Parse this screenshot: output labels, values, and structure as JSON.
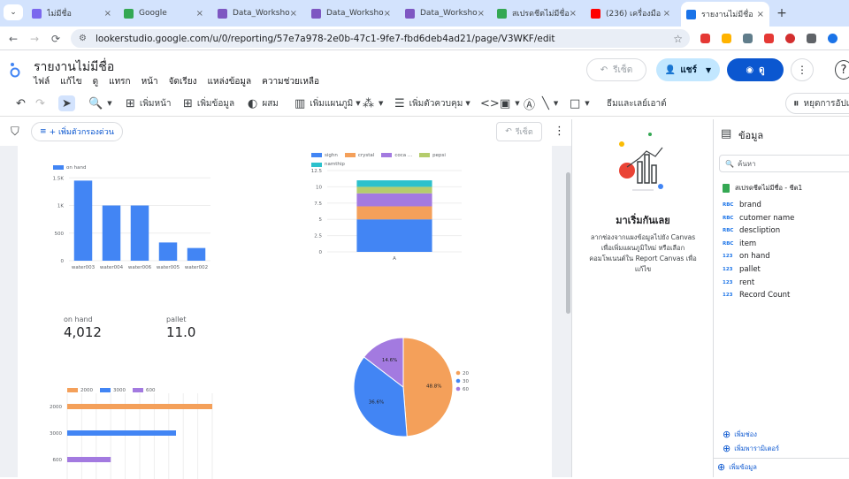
{
  "browser": {
    "tabs": [
      {
        "label": "ไม่มีชื่อ",
        "color": "#7b68ee"
      },
      {
        "label": "Google",
        "color": "#34a853"
      },
      {
        "label": "Data_Workshop",
        "color": "#7e57c2"
      },
      {
        "label": "Data_Workshop",
        "color": "#7e57c2"
      },
      {
        "label": "Data_Workshop",
        "color": "#7e57c2"
      },
      {
        "label": "สเปรดชีตไม่มีชื่อ - ",
        "color": "#34a853"
      },
      {
        "label": "(236) เครื่องมือ G",
        "color": "#ff0000"
      },
      {
        "label": "รายงานไม่มีชื่อ",
        "color": "#1a73e8"
      }
    ],
    "new_tab": "+",
    "url": "lookerstudio.google.com/u/0/reporting/57e7a978-2e0b-47c1-9fe7-fbd6deb4ad21/page/V3WKF/edit",
    "back": "←",
    "forward": "→",
    "reload": "⟳",
    "star": "☆"
  },
  "header": {
    "title": "รายงานไม่มีชื่อ",
    "menu": [
      "ไฟล์",
      "แก้ไข",
      "ดู",
      "แทรก",
      "หน้า",
      "จัดเรียง",
      "แหล่งข้อมูล",
      "ความช่วยเหลือ"
    ],
    "reset_label": "รีเซ็ต",
    "share_label": "แชร์",
    "view_label": "ดู",
    "accent": "#0b57d0"
  },
  "toolbar": {
    "add_page": "เพิ่มหน้า",
    "add_data": "เพิ่มข้อมูล",
    "blend": "ผสม",
    "add_chart": "เพิ่มแผนภูมิ",
    "add_control": "เพิ่มตัวควบคุม",
    "theme_layout": "ธีมและเลย์เอาต์",
    "pause": "หยุดการอัปเด"
  },
  "filter_row": {
    "add_quick_filter": "+ เพิ่มตัวกรองด่วน",
    "reset_label": "รีเซ็ต"
  },
  "start_panel": {
    "title": "มาเริ่มกันเลย",
    "body": "ลากช่องจากแผงข้อมูลไปยัง Canvas เพื่อเพิ่มแผนภูมิใหม่ หรือเลือกคอมโพเนนต์ใน Report Canvas เพื่อแก้ไข"
  },
  "data_panel": {
    "title": "ข้อมูล",
    "search_placeholder": "ค้นหา",
    "source": "สเปรดชีตไม่มีชื่อ - ชีต1",
    "fields": [
      {
        "type": "RBC",
        "name": "brand"
      },
      {
        "type": "RBC",
        "name": "cutomer name"
      },
      {
        "type": "RBC",
        "name": "descliption"
      },
      {
        "type": "RBC",
        "name": "item"
      },
      {
        "type": "123",
        "name": "on hand"
      },
      {
        "type": "123",
        "name": "pallet"
      },
      {
        "type": "123",
        "name": "rent"
      },
      {
        "type": "123",
        "name": "Record Count"
      }
    ],
    "add_field": "เพิ่มช่อง",
    "add_parameter": "เพิ่มพารามิเตอร์",
    "add_data": "เพิ่มข้อมูล"
  },
  "scorecards": [
    {
      "label": "on hand",
      "value": "4,012"
    },
    {
      "label": "pallet",
      "value": "11.0"
    }
  ],
  "chart_data": [
    {
      "type": "bar",
      "categories": [
        "water003",
        "water004",
        "water006",
        "water005",
        "water002"
      ],
      "series": [
        {
          "name": "on hand",
          "values": [
            1450,
            1000,
            1000,
            330,
            230
          ],
          "color": "#4285f4"
        }
      ],
      "yticks": [
        "0",
        "500",
        "1K",
        "1.5K"
      ],
      "ylim": [
        0,
        1600
      ]
    },
    {
      "type": "bar",
      "stacked": true,
      "categories": [
        "A"
      ],
      "series": [
        {
          "name": "sighn",
          "values": [
            5
          ],
          "color": "#4285f4"
        },
        {
          "name": "crystal",
          "values": [
            2
          ],
          "color": "#f4a05a"
        },
        {
          "name": "coca ...",
          "values": [
            2
          ],
          "color": "#a37ae0"
        },
        {
          "name": "pepsi",
          "values": [
            1
          ],
          "color": "#b5cc6c"
        },
        {
          "name": "namthip",
          "values": [
            1
          ],
          "color": "#2cc1cc"
        }
      ],
      "yticks": [
        "0",
        "2.5",
        "5",
        "7.5",
        "10",
        "12.5"
      ],
      "ylim": [
        0,
        12.5
      ]
    },
    {
      "type": "pie",
      "slices": [
        {
          "name": "2000",
          "value": 48.8,
          "label": "48.8%",
          "color": "#f4a05a"
        },
        {
          "name": "3000",
          "value": 36.6,
          "label": "36.6%",
          "color": "#4285f4"
        },
        {
          "name": "600",
          "value": 14.6,
          "label": "14.6%",
          "color": "#a37ae0"
        }
      ]
    },
    {
      "type": "bar",
      "orientation": "horizontal",
      "categories": [
        "2000",
        "3000",
        "600"
      ],
      "series": [
        {
          "name": "2000",
          "values": [
            2000
          ],
          "color": "#f4a05a"
        },
        {
          "name": "3000",
          "values": [
            1500
          ],
          "color": "#4285f4"
        },
        {
          "name": "600",
          "values": [
            600
          ],
          "color": "#a37ae0"
        }
      ],
      "xlim": [
        0,
        2000
      ]
    }
  ]
}
